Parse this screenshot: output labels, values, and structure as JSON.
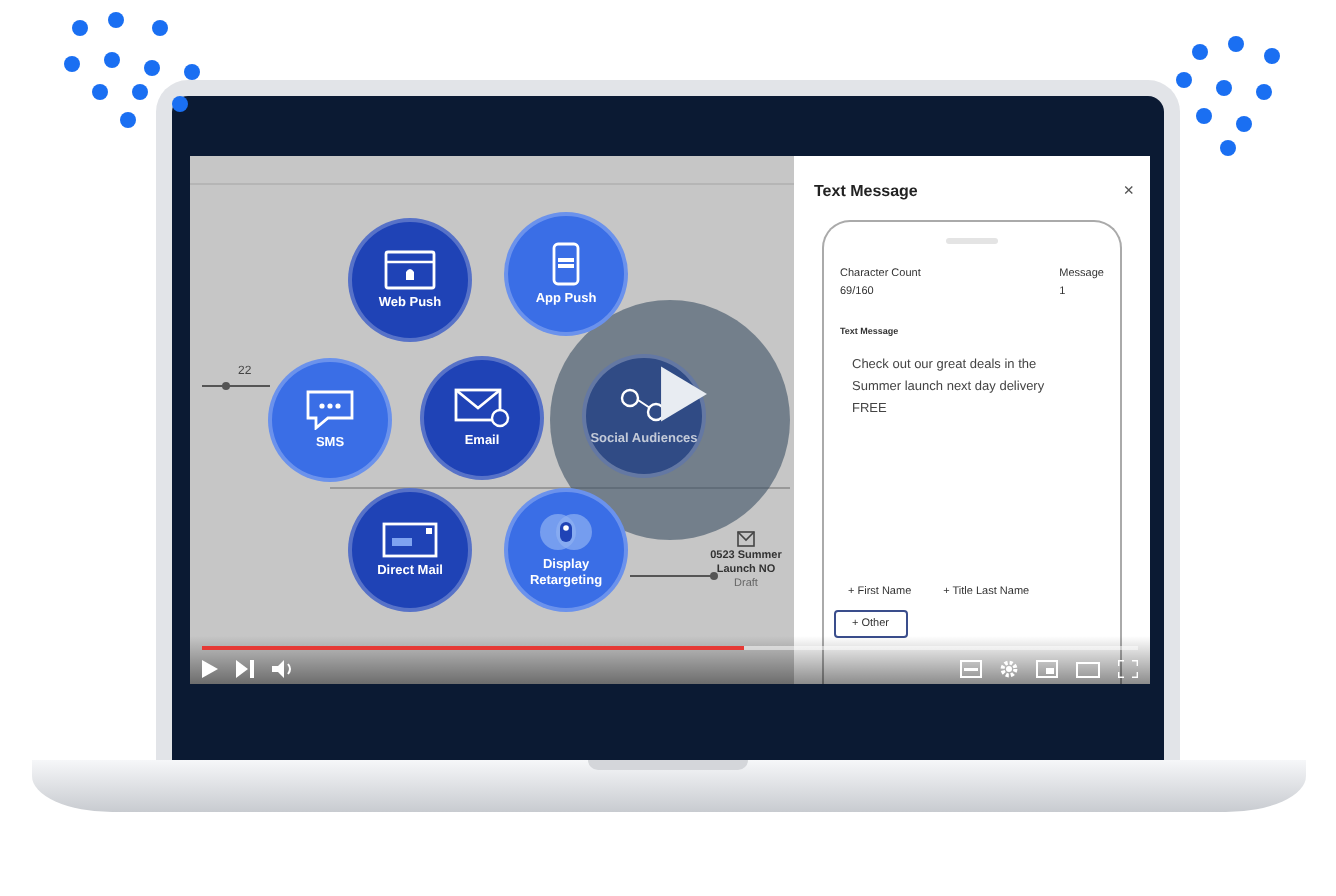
{
  "video": {
    "flow_canvas": {
      "nodes": [
        {
          "label": "Web Push",
          "kind": "web-push",
          "color": "#1f43b6"
        },
        {
          "label": "App Push",
          "kind": "app-push",
          "color": "#3a6ee6"
        },
        {
          "label": "SMS",
          "kind": "sms",
          "color": "#3a6ee6"
        },
        {
          "label": "Email",
          "kind": "email",
          "color": "#1f43b6"
        },
        {
          "label": "Social Audiences",
          "kind": "social",
          "color": "#304b85"
        },
        {
          "label": "Direct Mail",
          "kind": "direct-mail",
          "color": "#1f43b6"
        },
        {
          "label": "Display Retargeting",
          "kind": "display",
          "color": "#3a6ee6"
        }
      ],
      "step_label": "22",
      "campaign": {
        "name": "0523 Summer Launch NO",
        "status": "Draft"
      }
    },
    "panel": {
      "title": "Text Message",
      "close": "×",
      "character_count": {
        "label": "Character Count",
        "value": "69/160"
      },
      "message": {
        "label": "Message",
        "value": "1"
      },
      "body_label": "Text Message",
      "body": "Check out our great deals in the Summer launch next day delivery FREE",
      "tokens": [
        "+ First Name",
        "+ Title Last Name"
      ],
      "other_button": "+ Other"
    },
    "progress": {
      "level": 0.58
    }
  }
}
